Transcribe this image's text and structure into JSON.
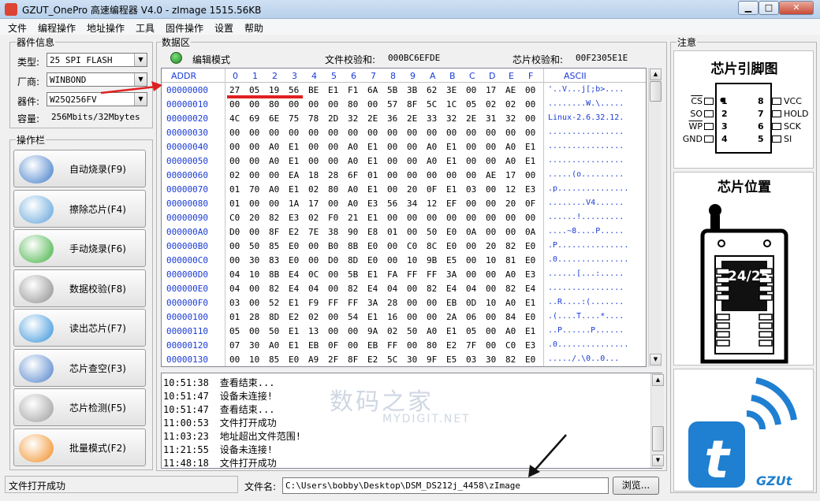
{
  "window": {
    "title": "GZUT_OnePro 高速编程器 V4.0 - zImage  1515.56KB",
    "min": "▁",
    "max": "□",
    "close": "✕"
  },
  "menu": [
    "文件",
    "编程操作",
    "地址操作",
    "工具",
    "固件操作",
    "设置",
    "帮助"
  ],
  "chip_info": {
    "group_label": "器件信息",
    "type_label": "类型:",
    "type_value": "25 SPI FLASH",
    "vendor_label": "厂商:",
    "vendor_value": "WINBOND",
    "device_label": "器件:",
    "device_value": "W25Q256FV",
    "capacity_label": "容量:",
    "capacity_value": "256Mbits/32Mbytes"
  },
  "ops": {
    "group_label": "操作栏",
    "buttons": [
      {
        "label": "自动烧录(F9)",
        "icon": "ie-globe-icon",
        "color": "#3a78c8"
      },
      {
        "label": "擦除芯片(F4)",
        "icon": "scissors-icon",
        "color": "#5aa0d8"
      },
      {
        "label": "手动烧录(F6)",
        "icon": "download-arrow-icon",
        "color": "#3cae3c"
      },
      {
        "label": "数据校验(F8)",
        "icon": "document-add-icon",
        "color": "#8a8a8a"
      },
      {
        "label": "读出芯片(F7)",
        "icon": "upload-arrow-icon",
        "color": "#2f8fd8"
      },
      {
        "label": "芯片查空(F3)",
        "icon": "book-magnifier-icon",
        "color": "#4a7fc8"
      },
      {
        "label": "芯片检测(F5)",
        "icon": "magnifier-icon",
        "color": "#9a9a9a"
      },
      {
        "label": "批量模式(F2)",
        "icon": "orange-slice-icon",
        "color": "#f08a1c"
      }
    ]
  },
  "data_area": {
    "group_label": "数据区",
    "mode": "编辑模式",
    "file_checksum_label": "文件校验和:",
    "file_checksum": "000BC6EFDE",
    "chip_checksum_label": "芯片校验和:",
    "chip_checksum": "00F2305E1E",
    "columns": [
      "ADDR",
      "0",
      "1",
      "2",
      "3",
      "4",
      "5",
      "6",
      "7",
      "8",
      "9",
      "A",
      "B",
      "C",
      "D",
      "E",
      "F",
      "ASCII"
    ],
    "rows": [
      {
        "addr": "00000000",
        "bytes": [
          "27",
          "05",
          "19",
          "56",
          "BE",
          "E1",
          "F1",
          "6A",
          "5B",
          "3B",
          "62",
          "3E",
          "00",
          "17",
          "AE",
          "00"
        ],
        "ascii": "'..V...j[;b>...."
      },
      {
        "addr": "00000010",
        "bytes": [
          "00",
          "00",
          "80",
          "00",
          "00",
          "00",
          "80",
          "00",
          "57",
          "8F",
          "5C",
          "1C",
          "05",
          "02",
          "02",
          "00"
        ],
        "ascii": "........W.\\....."
      },
      {
        "addr": "00000020",
        "bytes": [
          "4C",
          "69",
          "6E",
          "75",
          "78",
          "2D",
          "32",
          "2E",
          "36",
          "2E",
          "33",
          "32",
          "2E",
          "31",
          "32",
          "00"
        ],
        "ascii": "Linux-2.6.32.12."
      },
      {
        "addr": "00000030",
        "bytes": [
          "00",
          "00",
          "00",
          "00",
          "00",
          "00",
          "00",
          "00",
          "00",
          "00",
          "00",
          "00",
          "00",
          "00",
          "00",
          "00"
        ],
        "ascii": "................"
      },
      {
        "addr": "00000040",
        "bytes": [
          "00",
          "00",
          "A0",
          "E1",
          "00",
          "00",
          "A0",
          "E1",
          "00",
          "00",
          "A0",
          "E1",
          "00",
          "00",
          "A0",
          "E1"
        ],
        "ascii": "................"
      },
      {
        "addr": "00000050",
        "bytes": [
          "00",
          "00",
          "A0",
          "E1",
          "00",
          "00",
          "A0",
          "E1",
          "00",
          "00",
          "A0",
          "E1",
          "00",
          "00",
          "A0",
          "E1"
        ],
        "ascii": "................"
      },
      {
        "addr": "00000060",
        "bytes": [
          "02",
          "00",
          "00",
          "EA",
          "18",
          "28",
          "6F",
          "01",
          "00",
          "00",
          "00",
          "00",
          "00",
          "AE",
          "17",
          "00"
        ],
        "ascii": ".....(o........."
      },
      {
        "addr": "00000070",
        "bytes": [
          "01",
          "70",
          "A0",
          "E1",
          "02",
          "80",
          "A0",
          "E1",
          "00",
          "20",
          "0F",
          "E1",
          "03",
          "00",
          "12",
          "E3"
        ],
        "ascii": ".p..............."
      },
      {
        "addr": "00000080",
        "bytes": [
          "01",
          "00",
          "00",
          "1A",
          "17",
          "00",
          "A0",
          "E3",
          "56",
          "34",
          "12",
          "EF",
          "00",
          "00",
          "20",
          "0F"
        ],
        "ascii": "........V4......"
      },
      {
        "addr": "00000090",
        "bytes": [
          "C0",
          "20",
          "82",
          "E3",
          "02",
          "F0",
          "21",
          "E1",
          "00",
          "00",
          "00",
          "00",
          "00",
          "00",
          "00",
          "00"
        ],
        "ascii": "......!........."
      },
      {
        "addr": "000000A0",
        "bytes": [
          "D0",
          "00",
          "8F",
          "E2",
          "7E",
          "38",
          "90",
          "E8",
          "01",
          "00",
          "50",
          "E0",
          "0A",
          "00",
          "00",
          "0A"
        ],
        "ascii": "....~8....P....."
      },
      {
        "addr": "000000B0",
        "bytes": [
          "00",
          "50",
          "85",
          "E0",
          "00",
          "B0",
          "8B",
          "E0",
          "00",
          "C0",
          "8C",
          "E0",
          "00",
          "20",
          "82",
          "E0"
        ],
        "ascii": ".P..............."
      },
      {
        "addr": "000000C0",
        "bytes": [
          "00",
          "30",
          "83",
          "E0",
          "00",
          "D0",
          "8D",
          "E0",
          "00",
          "10",
          "9B",
          "E5",
          "00",
          "10",
          "81",
          "E0"
        ],
        "ascii": ".0..............."
      },
      {
        "addr": "000000D0",
        "bytes": [
          "04",
          "10",
          "8B",
          "E4",
          "0C",
          "00",
          "5B",
          "E1",
          "FA",
          "FF",
          "FF",
          "3A",
          "00",
          "00",
          "A0",
          "E3"
        ],
        "ascii": "......[...:....."
      },
      {
        "addr": "000000E0",
        "bytes": [
          "04",
          "00",
          "82",
          "E4",
          "04",
          "00",
          "82",
          "E4",
          "04",
          "00",
          "82",
          "E4",
          "04",
          "00",
          "82",
          "E4"
        ],
        "ascii": "................"
      },
      {
        "addr": "000000F0",
        "bytes": [
          "03",
          "00",
          "52",
          "E1",
          "F9",
          "FF",
          "FF",
          "3A",
          "28",
          "00",
          "00",
          "EB",
          "0D",
          "10",
          "A0",
          "E1"
        ],
        "ascii": "..R....:(......."
      },
      {
        "addr": "00000100",
        "bytes": [
          "01",
          "28",
          "8D",
          "E2",
          "02",
          "00",
          "54",
          "E1",
          "16",
          "00",
          "00",
          "2A",
          "06",
          "00",
          "84",
          "E0"
        ],
        "ascii": ".(....T....*...."
      },
      {
        "addr": "00000110",
        "bytes": [
          "05",
          "00",
          "50",
          "E1",
          "13",
          "00",
          "00",
          "9A",
          "02",
          "50",
          "A0",
          "E1",
          "05",
          "00",
          "A0",
          "E1"
        ],
        "ascii": "..P......P......"
      },
      {
        "addr": "00000120",
        "bytes": [
          "07",
          "30",
          "A0",
          "E1",
          "EB",
          "0F",
          "00",
          "EB",
          "FF",
          "00",
          "80",
          "E2",
          "7F",
          "00",
          "C0",
          "E3"
        ],
        "ascii": ".0..............."
      },
      {
        "addr": "00000130",
        "bytes": [
          "00",
          "10",
          "85",
          "E0",
          "A9",
          "2F",
          "8F",
          "E2",
          "5C",
          "30",
          "9F",
          "E5",
          "03",
          "30",
          "82",
          "E0"
        ],
        "ascii": "...../.\\0..0..."
      }
    ]
  },
  "log": [
    {
      "time": "10:51:38",
      "msg": "查看结束..."
    },
    {
      "time": "10:51:47",
      "msg": "设备未连接!"
    },
    {
      "time": "10:51:47",
      "msg": "查看结束..."
    },
    {
      "time": "11:00:53",
      "msg": "文件打开成功"
    },
    {
      "time": "11:03:23",
      "msg": "地址超出文件范围!"
    },
    {
      "time": "11:21:55",
      "msg": "设备未连接!"
    },
    {
      "time": "11:48:18",
      "msg": "文件打开成功"
    }
  ],
  "status": {
    "text": "文件打开成功",
    "file_label": "文件名:",
    "file_path": "C:\\Users\\bobby\\Desktop\\DSM_DS212j_4458\\zImage",
    "browse": "浏览..."
  },
  "notes": {
    "group_label": "注意",
    "pinout_title": "芯片引脚图",
    "pins_left": [
      {
        "name": "CS",
        "n": "1"
      },
      {
        "name": "SO",
        "n": "2"
      },
      {
        "name": "WP",
        "n": "3"
      },
      {
        "name": "GND",
        "n": "4"
      }
    ],
    "pins_right": [
      {
        "name": "VCC",
        "n": "8"
      },
      {
        "name": "HOLD",
        "n": "7"
      },
      {
        "name": "SCK",
        "n": "6"
      },
      {
        "name": "SI",
        "n": "5"
      }
    ],
    "position_title": "芯片位置",
    "socket_label": "24/25",
    "logo_text": "GZUt"
  },
  "watermark": {
    "cn": "数码之家",
    "en": "MYDIGIT.NET"
  },
  "colors": {
    "accent_blue": "#1a3bd6",
    "annotation_red": "#e02020",
    "logo_blue": "#1f7fd0"
  }
}
